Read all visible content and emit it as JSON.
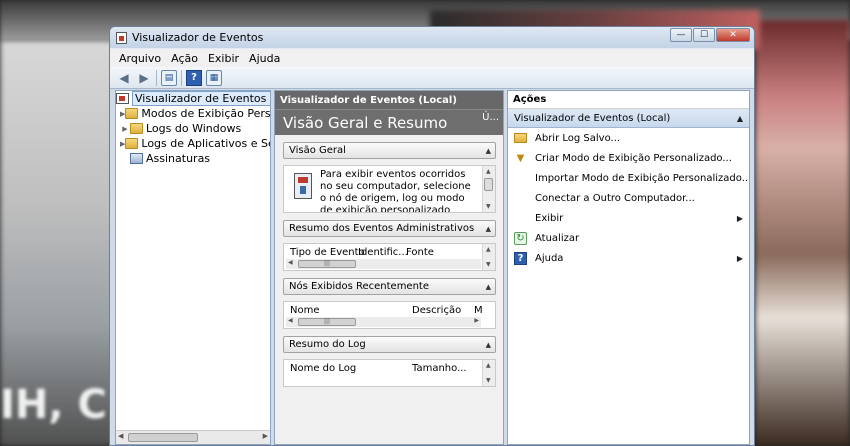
{
  "window": {
    "title": "Visualizador de Eventos",
    "buttons": {
      "minimize": "—",
      "maximize": "☐",
      "close": "✕"
    }
  },
  "menu": [
    "Arquivo",
    "Ação",
    "Exibir",
    "Ajuda"
  ],
  "tree": {
    "items": [
      {
        "label": "Visualizador de Eventos (Local)",
        "icon": "event-viewer-icon",
        "selected": true
      },
      {
        "label": "Modos de Exibição Personalizados",
        "icon": "folder-icon"
      },
      {
        "label": "Logs do Windows",
        "icon": "folder-icon"
      },
      {
        "label": "Logs de Aplicativos e Serviços",
        "icon": "folder-icon"
      },
      {
        "label": "Assinaturas",
        "icon": "subscriptions-icon"
      }
    ]
  },
  "middle": {
    "header": "Visualizador de Eventos (Local)",
    "banner": "Visão Geral e Resumo",
    "banner_more": "Ú...",
    "sections": {
      "overview": {
        "title": "Visão Geral",
        "text": "Para exibir eventos ocorridos no seu computador, selecione o nó de origem, log ou modo de exibição personalizado"
      },
      "admin": {
        "title": "Resumo dos Eventos Administrativos",
        "columns": [
          "Tipo de Evento",
          "Identific...",
          "Fonte"
        ]
      },
      "recent": {
        "title": "Nós Exibidos Recentemente",
        "columns": [
          "Nome",
          "Descrição",
          "M"
        ]
      },
      "log": {
        "title": "Resumo do Log",
        "columns": [
          "Nome do Log",
          "Tamanho..."
        ]
      }
    }
  },
  "actions": {
    "header": "Ações",
    "subheader": "Visualizador de Eventos (Local)",
    "items": [
      {
        "label": "Abrir Log Salvo...",
        "icon": "open-log-icon"
      },
      {
        "label": "Criar Modo de Exibição Personalizado...",
        "icon": "filter-icon"
      },
      {
        "label": "Importar Modo de Exibição Personalizado...",
        "icon": ""
      },
      {
        "label": "Conectar a Outro Computador...",
        "icon": ""
      },
      {
        "label": "Exibir",
        "icon": "",
        "submenu": true
      },
      {
        "label": "Atualizar",
        "icon": "refresh-icon"
      },
      {
        "label": "Ajuda",
        "icon": "help-icon",
        "submenu": true
      }
    ]
  },
  "background": {
    "ghost_text": "IH, C",
    "ghost_text_right": "..."
  }
}
